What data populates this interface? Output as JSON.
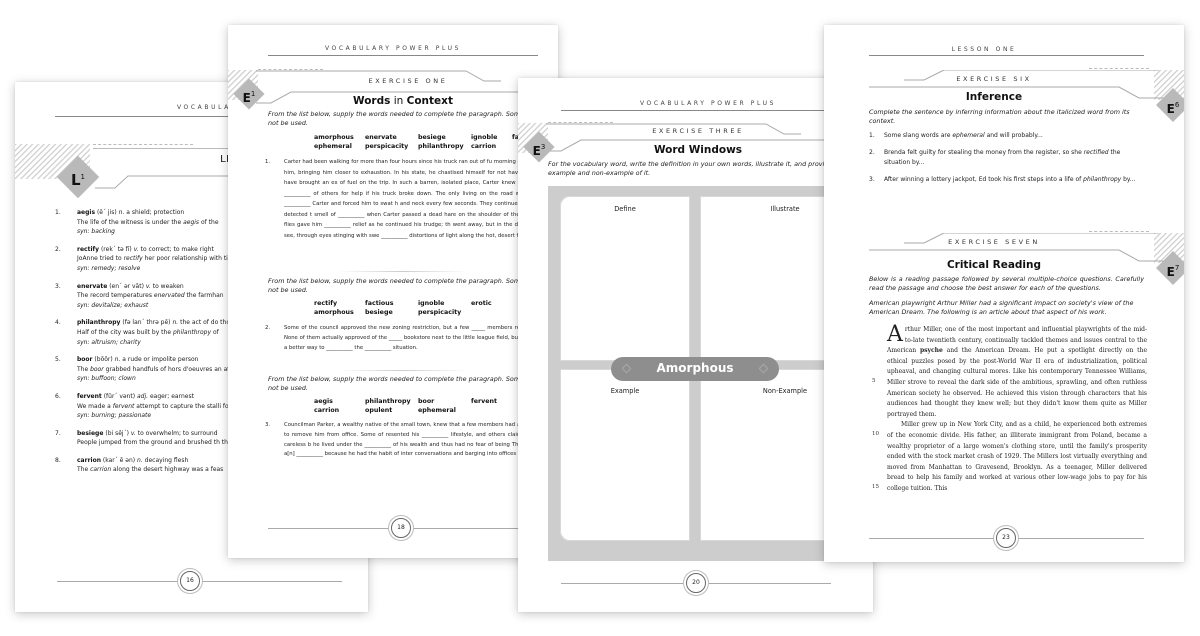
{
  "pages": {
    "lesson": {
      "running_head": "VOCABULARY POWER PLUS",
      "lesson_title": "LESSON ONE",
      "badge": {
        "letter": "L",
        "number": "1"
      },
      "entries": [
        {
          "n": "1.",
          "word": "aegis",
          "pron": "(ē´ jis)",
          "pos": "n.",
          "def": "a shield; protection",
          "example_pre": "The life of the witness is under the ",
          "example_ital": "aegis",
          "example_post": " of the ",
          "syn": "syn: backing"
        },
        {
          "n": "2.",
          "word": "rectify",
          "pron": "(rek´ tə fī)",
          "pos": "v.",
          "def": "to correct; to make right",
          "example_pre": "JoAnne tried to ",
          "example_ital": "rectify",
          "example_post": " her poor relationship with time with him.",
          "syn": "syn: remedy; resolve"
        },
        {
          "n": "3.",
          "word": "enervate",
          "pron": "(en´ ər vāt)",
          "pos": "v.",
          "def": "to weaken",
          "example_pre": "The record temperatures ",
          "example_ital": "enervated",
          "example_post": " the farmhan",
          "syn": "syn: devitalize; exhaust"
        },
        {
          "n": "4.",
          "word": "philanthropy",
          "pron": "(fə lan´ thrə pē)",
          "pos": "n.",
          "def": "the act of do those in need",
          "example_pre": "Half of the city was built by the ",
          "example_ital": "philanthropy",
          "example_post": " of",
          "syn": "syn: altruism; charity"
        },
        {
          "n": "5.",
          "word": "boor",
          "pron": "(bŏŏr)",
          "pos": "n.",
          "def": "a rude or impolite person",
          "example_pre": "The ",
          "example_ital": "boor",
          "example_post": " grabbed handfuls of hors d'oeuvres an ate them.",
          "syn": "syn: buffoon; clown"
        },
        {
          "n": "6.",
          "word": "fervent",
          "pron": "(fûr´ vənt)",
          "pos": "adj.",
          "def": "eager; earnest",
          "example_pre": "We made a ",
          "example_ital": "fervent",
          "example_post": " attempt to capture the stalli for us.",
          "syn": "syn: burning; passionate"
        },
        {
          "n": "7.",
          "word": "besiege",
          "pron": "(bi sēj´)",
          "pos": "v.",
          "def": "to overwhelm; to surround",
          "example_pre": "People jumped from the ground and brushed th the picnic.",
          "example_ital": "",
          "example_post": "",
          "syn": ""
        },
        {
          "n": "8.",
          "word": "carrion",
          "pron": "(kar´ ē ən)",
          "pos": "n.",
          "def": "decaying flesh",
          "example_pre": "The ",
          "example_ital": "carrion",
          "example_post": " along the desert highway was a feas",
          "syn": ""
        }
      ],
      "folio": "16"
    },
    "exercise_one": {
      "running_head": "VOCABULARY POWER PLUS",
      "banner": "EXERCISE ONE",
      "badge": {
        "letter": "E",
        "number": "1"
      },
      "title_bold_1": "Words",
      "title_normal": " in ",
      "title_bold_2": "Context",
      "instruction": "From the list below, supply the words needed to complete the paragraph. Some words will not be used.",
      "groups": [
        {
          "words": [
            "amorphous",
            "enervate",
            "besiege",
            "ignoble",
            "fact",
            "ephemeral",
            "perspicacity",
            "philanthropy",
            "carrion",
            ""
          ],
          "n": "1.",
          "paragraph": "Carter had been walking for more than four hours since his truck ran out of fu morning desert sun __________ him, bringing him closer to exhaustion. In his state, he chastised himself for not having the __________ to have brought an ex of fuel on the trip. In such a barren, isolated place, Carter knew that he could on the __________ of others for help if his truck broke down. The only living on the road were biting flies that __________ Carter and forced him to swat h and neck every few seconds. They continued to attack until they detected t smell of __________ when Carter passed a dead hare on the shoulder of the ro departure of the flies gave him __________ relief as he continued his trudge; th went away, but in the distance, Carter could see, through eyes stinging with swe __________ distortions of light along the hot, desert floor."
        },
        {
          "words": [
            "rectify",
            "factious",
            "ignoble",
            "erotic",
            "",
            "amorphous",
            "besiege",
            "perspicacity",
            "",
            ""
          ],
          "n": "2.",
          "paragraph": "Some of the council approved the new zoning restriction, but a few _____ members refused to cast votes. None of them actually approved of the _____ bookstore next to the little league field, but they wanted to find a better way to __________ the __________ situation."
        },
        {
          "words": [
            "aegis",
            "philanthropy",
            "boor",
            "fervent",
            "",
            "carrion",
            "opulent",
            "ephemeral",
            "",
            ""
          ],
          "n": "3.",
          "paragraph": "Councilman Parker, a wealthy native of the small town, knew that a few members had a[n] __________ desire to remove him from office. Some of resented his __________ lifestyle, and others claimed that Parker was careless b he lived under the __________ of his wealth and thus had no fear of being They also called Parker a[n] __________ because he had the habit of inter conversations and barging into offices without knocking."
        }
      ],
      "folio": "18"
    },
    "exercise_three": {
      "running_head": "VOCABULARY POWER PLUS",
      "banner": "EXERCISE THREE",
      "badge": {
        "letter": "E",
        "number": "3"
      },
      "title": "Word Windows",
      "instruction": "For the vocabulary word, write the definition in your own words, illustrate it, and provide both an example and non-example of it.",
      "cells": [
        "Define",
        "Illustrate",
        "Example",
        "Non-Example"
      ],
      "word": "Amorphous",
      "folio": "20"
    },
    "exercise_six_seven": {
      "running_head": "LESSON ONE",
      "ex6": {
        "banner": "EXERCISE SIX",
        "badge": {
          "letter": "E",
          "number": "6"
        },
        "title": "Inference",
        "instruction": "Complete the sentence by inferring information about the italicized word from its context.",
        "items": [
          {
            "n": "1.",
            "pre": "Some slang words are ",
            "ital": "ephemeral",
            "post": " and will probably..."
          },
          {
            "n": "2.",
            "pre": "Brenda felt guilty for stealing the money from the register, so she ",
            "ital": "rectified",
            "post": " the situation by..."
          },
          {
            "n": "3.",
            "pre": "After winning a lottery jackpot, Ed took his first steps into a life of ",
            "ital": "philanthropy",
            "post": " by..."
          }
        ]
      },
      "ex7": {
        "banner": "EXERCISE SEVEN",
        "badge": {
          "letter": "E",
          "number": "7"
        },
        "title": "Critical Reading",
        "instruction": "Below is a reading passage followed by several multiple-choice questions. Carefully read the passage and choose the best answer for each of the questions.",
        "intro": "American playwright Arthur Miller had a significant impact on society's view of the American Dream. The following is an article about that aspect of his work.",
        "dropcap": "A",
        "p1_a": "rthur Miller, one of the most important and influential playwrights of the mid-to-late twentieth century, continually tackled themes and issues central to the American ",
        "p1_bold": "psyche",
        "p1_b": " and the American Dream. He put a spotlight directly on the ethical puzzles posed by the post-World War II era of industrialization, political upheaval, and changing cultural mores. Like his contemporary Tennessee Williams, Miller strove to reveal the dark side of the ambitious, sprawling, and often ruthless American society he observed. He achieved this vision through characters that his audiences had thought they knew well; but they didn't know them quite as Miller portrayed them.",
        "p2": "Miller grew up in New York City, and as a child, he experienced both extremes of the economic divide. His father, an illiterate immigrant from Poland, became a wealthy proprietor of a large women's clothing store, until the family's prosperity ended with the stock market crash of 1929. The Millers lost virtually everything and moved from Manhattan to Gravesend, Brooklyn. As a teenager, Miller delivered bread to help his family and worked at various other low-wage jobs to pay for his college tuition. This",
        "line_numbers": [
          "5",
          "10",
          "15"
        ]
      },
      "folio": "23"
    }
  }
}
